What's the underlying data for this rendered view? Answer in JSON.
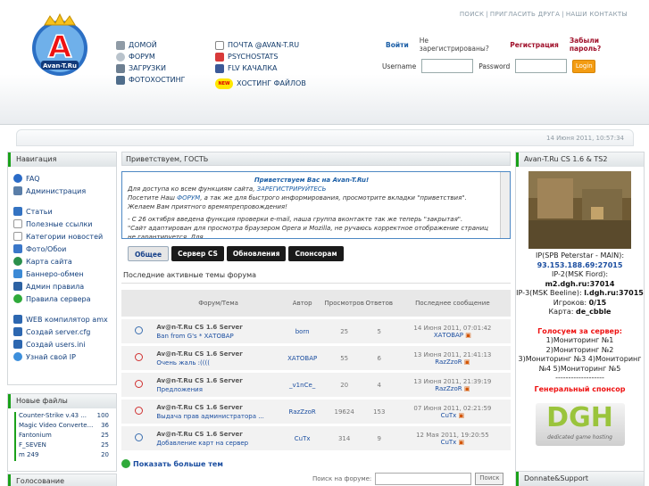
{
  "header": {
    "logo_text": "Avan-T.Ru",
    "toplinks": [
      "ПОИСК",
      "ПРИГЛАСИТЬ ДРУГА",
      "НАШИ КОНТАКТЫ"
    ],
    "nav_left": [
      {
        "label": "ДОМОЙ",
        "icon": "home-icon"
      },
      {
        "label": "ФОРУМ",
        "icon": "forum-icon"
      },
      {
        "label": "ЗАГРУЗКИ",
        "icon": "download-icon"
      },
      {
        "label": "ФОТОХОСТИНГ",
        "icon": "photo-icon"
      }
    ],
    "nav_right": [
      {
        "label": "ПОЧТА @AVAN-T.RU",
        "icon": "mail-icon"
      },
      {
        "label": "PSYCHOSTATS",
        "icon": "stats-icon"
      },
      {
        "label": "FLV КАЧАЛКА",
        "icon": "facebook-icon"
      },
      {
        "label": "ХОСТИНГ ФАЙЛОВ",
        "icon": "new-badge-icon",
        "badge": "NEW"
      }
    ],
    "login": {
      "enter": "Войти",
      "not_registered": "Не зарегистрированы?",
      "register": "Регистрация",
      "forgot": "Забыли пароль?",
      "username_label": "Username",
      "password_label": "Password",
      "button": "Login"
    }
  },
  "datetime": "14 Июня 2011, 10:57:34",
  "navigation": {
    "title": "Навигация",
    "group1": [
      "FAQ",
      "Администрация"
    ],
    "group2": [
      "Статьи",
      "Полезные ссылки",
      "Категории новостей",
      "Фото/Обои",
      "Карта сайта",
      "Баннеро-обмен",
      "Админ правила",
      "Правила сервера"
    ],
    "group3": [
      "WEB компилятор amx",
      "Создай server.cfg",
      "Создай users.ini",
      "Узнай свой IP"
    ]
  },
  "new_files": {
    "title": "Новые файлы",
    "items": [
      {
        "name": "Counter-Strike v.43 ...",
        "count": "100"
      },
      {
        "name": "Magic Video Converte...",
        "count": "36"
      },
      {
        "name": "Fantonium",
        "count": "25"
      },
      {
        "name": "F_SEVEN",
        "count": "25"
      },
      {
        "name": "m 249",
        "count": "20"
      }
    ]
  },
  "poll_title": "Голосование",
  "center": {
    "greeting": "Приветствуем, ГОСТЬ",
    "welcome_title": "Приветствуем Вас на Avan-T.Ru!",
    "welcome_line1a": "Для доступа ко всем функциям сайта, ",
    "welcome_line1b": "ЗАРЕГИСТРИРУЙТЕСЬ",
    "welcome_line2a": "Посетите Наш ",
    "welcome_line2b": "ФОРУМ",
    "welcome_line2c": ", а так же для быстрого информирования, просмотрите вкладки \"приветствия\". Желаем Вам приятного времяпрепровождения!",
    "welcome_line3": "- С 26 октября введена функция проверки e-mail, наша группа вконтакте так же теперь \"закрытая\".",
    "welcome_line4": "\"Сайт адаптирован для просмотра браузером Opera и Mozilla, не ручаюсь корректное отображение страниц не гарантируется. Для",
    "tabs": [
      "Общее",
      "Сервер CS",
      "Обновления",
      "Спонсорам"
    ],
    "active_title": "Последние активные темы форума",
    "columns": [
      "Форум/Тема",
      "Автор",
      "Просмотров",
      "Ответов",
      "Последнее сообщение"
    ],
    "rows": [
      {
        "forum": "Av@n-T.Ru CS 1.6 Server",
        "topic": "Ban from G's * ХАТОВАР",
        "author": "born",
        "views": "25",
        "replies": "5",
        "last_date": "14 Июня 2011, 07:01:42",
        "last_user": "ХАТОВАР",
        "icon_color": "#3b6fb0"
      },
      {
        "forum": "Av@n-T.Ru CS 1.6 Server",
        "topic": "Очень жаль :((((",
        "author": "ХАТОВАР",
        "views": "55",
        "replies": "6",
        "last_date": "13 Июня 2011, 21:41:13",
        "last_user": "RazZzoR",
        "icon_color": "#d03030"
      },
      {
        "forum": "Av@n-T.Ru CS 1.6 Server",
        "topic": "Предложения",
        "author": "_v1nCe_",
        "views": "20",
        "replies": "4",
        "last_date": "13 Июня 2011, 21:39:19",
        "last_user": "RazZzoR",
        "icon_color": "#d03030"
      },
      {
        "forum": "Av@n-T.Ru CS 1.6 Server",
        "topic": "Выдача прав администратора ...",
        "author": "RazZzoR",
        "views": "19624",
        "replies": "153",
        "last_date": "07 Июня 2011, 02:21:59",
        "last_user": "CuTx",
        "icon_color": "#d03030"
      },
      {
        "forum": "Av@n-T.Ru CS 1.6 Server",
        "topic": "Добавление карт на сервер",
        "author": "CuTx",
        "views": "314",
        "replies": "9",
        "last_date": "12 Мая 2011, 19:20:55",
        "last_user": "CuTx",
        "icon_color": "#3b6fb0"
      }
    ],
    "show_more": "Показать больше тем",
    "search_label": "Поиск на форуме:",
    "search_button": "Поиск"
  },
  "right": {
    "title": "Avan-T.Ru CS 1.6 & TS2",
    "ip_label": "IP(SPB Peterstar - MAIN):",
    "ip_main": "93.153.188.69:27015",
    "ip2_label": "IP-2(MSK Fiord):",
    "ip2": "m2.dgh.ru:37014",
    "ip3_label": "IP-3(MSK Beeline):",
    "ip3": "l.dgh.ru:37015",
    "players_label": "Игроков:",
    "players": "0/15",
    "map_label": "Карта:",
    "map": "de_cbble",
    "vote_title": "Голосуем за сервер:",
    "vote_lines": [
      "1)Мониторинг №1",
      "2)Мониторинг №2",
      "3)Мониторинг №3 4)Мониторинг",
      "№4 5)Мониторинг №5"
    ],
    "divider": "-------------------",
    "sponsor_title": "Генеральный спонсор",
    "sponsor_logo": "DGH",
    "sponsor_sub": "dedicated game hosting",
    "donate_title": "Donnate&Support"
  }
}
